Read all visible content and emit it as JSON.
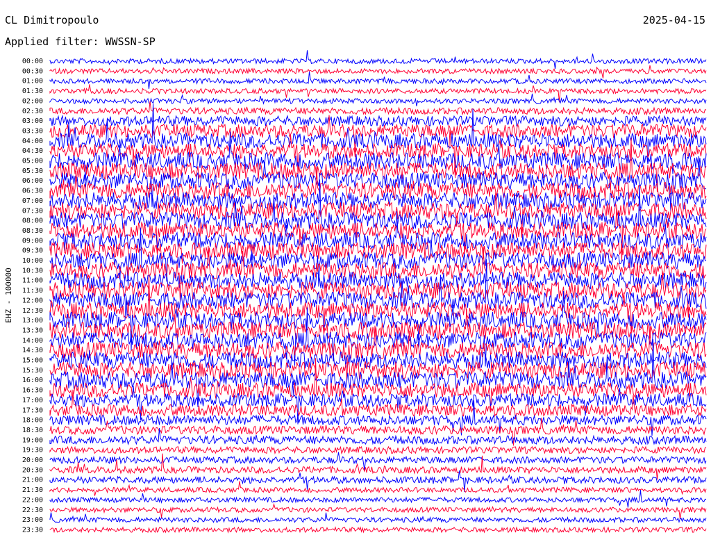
{
  "header": {
    "station": "CL Dimitropoulo",
    "date": "2025-04-15",
    "filter_label": "Applied filter: WWSSN-SP"
  },
  "chart_data": {
    "type": "line",
    "chart_kind": "helicorder",
    "channel_label": "EHZ - 100000",
    "row_labels": [
      "00:00",
      "00:30",
      "01:00",
      "01:30",
      "02:00",
      "02:30",
      "03:00",
      "03:30",
      "04:00",
      "04:30",
      "05:00",
      "05:30",
      "06:00",
      "06:30",
      "07:00",
      "07:30",
      "08:00",
      "08:30",
      "09:00",
      "09:30",
      "10:00",
      "10:30",
      "11:00",
      "11:30",
      "12:00",
      "12:30",
      "13:00",
      "13:30",
      "14:00",
      "14:30",
      "15:00",
      "15:30",
      "16:00",
      "16:30",
      "17:00",
      "17:30",
      "18:00",
      "18:30",
      "19:00",
      "19:30",
      "20:00",
      "20:30",
      "21:00",
      "21:30",
      "22:00",
      "22:30",
      "23:00",
      "23:30"
    ],
    "series_colors": [
      "#0000ff",
      "#ff0033"
    ],
    "row_amplitude_level": [
      3,
      3,
      3,
      3,
      3,
      4,
      6,
      8,
      9,
      9,
      10,
      10,
      10,
      10,
      10,
      10,
      10,
      10,
      10,
      10,
      10,
      10,
      10,
      10,
      10,
      10,
      10,
      10,
      10,
      10,
      10,
      10,
      10,
      9,
      8,
      7,
      6,
      5,
      5,
      4,
      4,
      4,
      4,
      3,
      3,
      3,
      3,
      3
    ],
    "grid": false
  }
}
